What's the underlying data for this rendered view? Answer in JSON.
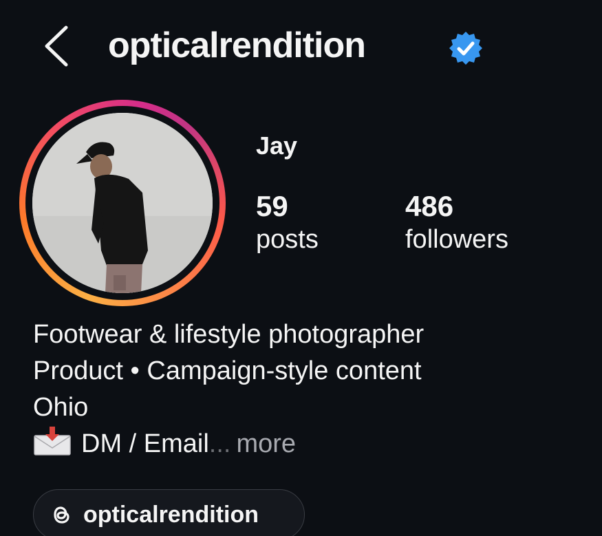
{
  "header": {
    "username": "opticalrendition",
    "verified_color": "#3897f0"
  },
  "profile": {
    "display_name": "Jay",
    "ring_colors": [
      "#fcb045",
      "#fd1d1d",
      "#c13584"
    ]
  },
  "stats": {
    "posts_count": "59",
    "posts_label": "posts",
    "followers_count": "486",
    "followers_label": "followers"
  },
  "bio": {
    "line1": "Footwear & lifestyle photographer",
    "line2": "Product • Campaign-style content",
    "line3": "Ohio",
    "line4": "DM / Email",
    "ellipsis": "...",
    "more": "more"
  },
  "threads": {
    "label": "opticalrendition",
    "icon": "threads-icon"
  }
}
